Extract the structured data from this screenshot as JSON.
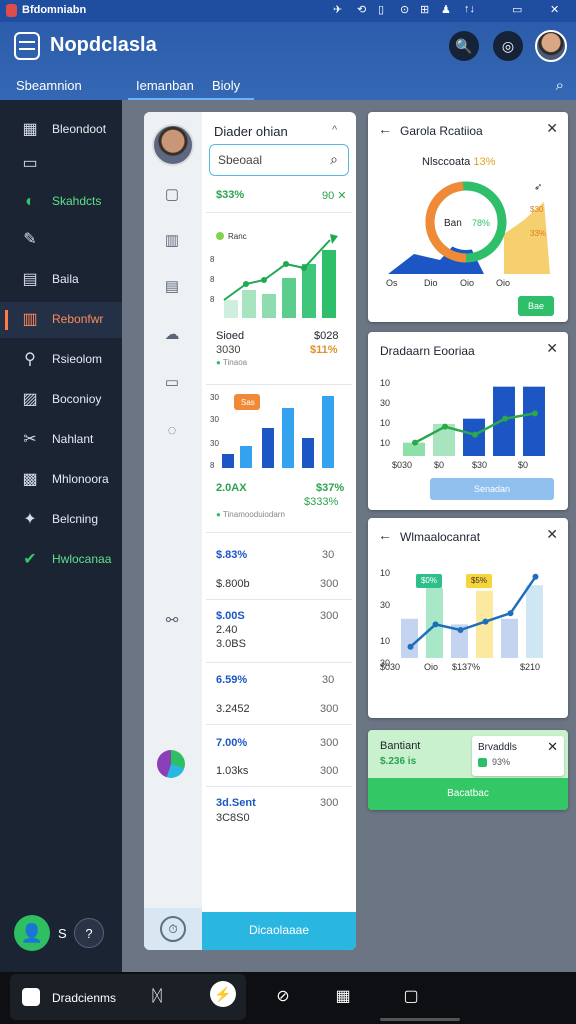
{
  "status": {
    "title": "Bfdomniabn",
    "icons": [
      "✈",
      "⟲",
      "▯",
      "⊙",
      "⊞",
      "♟",
      "↑↓",
      "▭",
      "✕"
    ]
  },
  "header": {
    "app_title": "Nopdclasla",
    "nav_tabs": [
      "Sbeamnion",
      "Iemanban",
      "Bioly"
    ],
    "btn_search": "🔍",
    "btn_settings": "◎"
  },
  "sidebar": {
    "items": [
      {
        "label": "Bleondoot",
        "icon": "▦"
      },
      {
        "label": "",
        "icon": "▭"
      },
      {
        "label": "Skahdcts",
        "icon": "◐"
      },
      {
        "label": "",
        "icon": "✎"
      },
      {
        "label": "Baila",
        "icon": "▤"
      },
      {
        "label": "Rebonfwr",
        "icon": "▥"
      },
      {
        "label": "Rsieolom",
        "icon": "⚲"
      },
      {
        "label": "Boconioy",
        "icon": "▨"
      },
      {
        "label": "Nahlant",
        "icon": "✂"
      },
      {
        "label": "Mhlonoora",
        "icon": "▩"
      },
      {
        "label": "Belcning",
        "icon": "✦"
      },
      {
        "label": "Hwlocanaa",
        "icon": "✔"
      }
    ],
    "user_initial": "S",
    "help_icon": "?",
    "user_icon": "👤"
  },
  "middle": {
    "heading": "Diader ohian",
    "chevron": "^",
    "search": {
      "placeholder": "Sbeoaal"
    },
    "summary1": {
      "left": "$33%",
      "right": "90 ✕"
    },
    "chart1": {
      "ytick": "Ranc",
      "bottom_left": "Sioed",
      "bottom_left2": "3030",
      "bottom_right": "$028",
      "bottom_right2": "$11%",
      "legend": "Tinaoa"
    },
    "chart2": {
      "badge": "Sas",
      "ytick": "30",
      "bottom_left": "2.0AX",
      "bottom_right": "$37%",
      "bottom_right2": "$333%",
      "legend": "Tinamooduiodarn"
    },
    "list": [
      {
        "a": "$.83%",
        "b": "30",
        "c": "$.800b",
        "d": "300"
      },
      {
        "a": "$.00S",
        "b": "300",
        "c": "2.40",
        "d": "3.0BS"
      },
      {
        "a": "6.59%",
        "b": "30",
        "c": "3.2452",
        "d": "300"
      },
      {
        "a": "7.00%",
        "b": "300",
        "c": "1.03ks",
        "d": "300"
      },
      {
        "a": "3d.Sent",
        "b": "300",
        "c": "3C8S0",
        "d": ""
      }
    ],
    "cta": "Dicaolaaae"
  },
  "cards": {
    "c1": {
      "title": "Garola Rcatiioa",
      "subtitle": "Nlsccoata",
      "subtitle_val": "13%",
      "donut_text": "Ban",
      "donut_pct": "78%",
      "bar1": "$30",
      "bar2": "33%",
      "xticks": [
        "Os",
        "Dio",
        "Oio",
        "Oio"
      ],
      "button": "Bae"
    },
    "c2": {
      "title": "Dradaarn Eooriaa",
      "yticks": [
        "10",
        "30",
        "10",
        "10",
        "10"
      ],
      "xticks": [
        "$030",
        "$0",
        "$30",
        "$0"
      ],
      "button": "Senadan",
      "chart_data": {
        "type": "bar",
        "categories": [
          "1",
          "2",
          "3",
          "4",
          "5"
        ],
        "values": [
          5,
          12,
          14,
          26,
          26
        ],
        "line": [
          5,
          11,
          8,
          14,
          16
        ],
        "ylim": [
          0,
          30
        ]
      }
    },
    "c3": {
      "title": "Wlmaalocanrat",
      "yticks": [
        "10",
        "30",
        "10",
        "30"
      ],
      "badges": [
        "$0%",
        "$5%"
      ],
      "xticks": [
        "$030",
        "Oio",
        "$137%",
        "$210"
      ],
      "chart_data": {
        "type": "bar",
        "categories": [
          "1",
          "2",
          "3",
          "4",
          "5",
          "6"
        ],
        "values": [
          14,
          25,
          12,
          24,
          14,
          26
        ],
        "line": [
          4,
          12,
          10,
          13,
          16,
          29
        ],
        "ylim": [
          0,
          30
        ]
      }
    },
    "c4": {
      "title": "Bantiant",
      "value": "$.236 is",
      "popup_title": "Brvaddls",
      "popup_val": "93%",
      "button": "Bacatbac"
    }
  },
  "taskbar": {
    "start_label": "Dradcienms",
    "icons": [
      "ᛞ",
      "⬤",
      "⊘",
      "▦",
      "▢"
    ]
  }
}
